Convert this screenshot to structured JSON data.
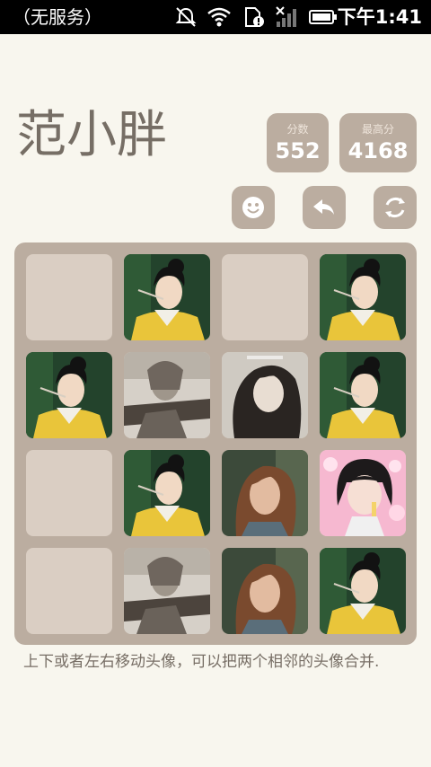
{
  "status_bar": {
    "carrier": "（无服务）",
    "time": "下午1:41",
    "icons": [
      "alarm-off-icon",
      "wifi-icon",
      "sim-alert-icon",
      "no-signal-icon",
      "battery-icon"
    ]
  },
  "header": {
    "title": "范小胖",
    "score": {
      "label": "分数",
      "value": "552"
    },
    "best": {
      "label": "最高分",
      "value": "4168"
    }
  },
  "controls": {
    "icons": [
      "smiley-icon",
      "undo-arrow-icon",
      "restart-icon"
    ]
  },
  "board": {
    "rows": [
      [
        "empty",
        "qing-dress-portrait",
        "empty",
        "qing-dress-portrait"
      ],
      [
        "qing-dress-portrait",
        "warrior-portrait",
        "bw-portrait",
        "qing-dress-portrait"
      ],
      [
        "empty",
        "qing-dress-portrait",
        "brown-hair-portrait",
        "pink-bob-portrait"
      ],
      [
        "empty",
        "warrior-portrait",
        "brown-hair-portrait",
        "qing-dress-portrait"
      ]
    ]
  },
  "hint": "上下或者左右移动头像，可以把两个相邻的头像合并."
}
